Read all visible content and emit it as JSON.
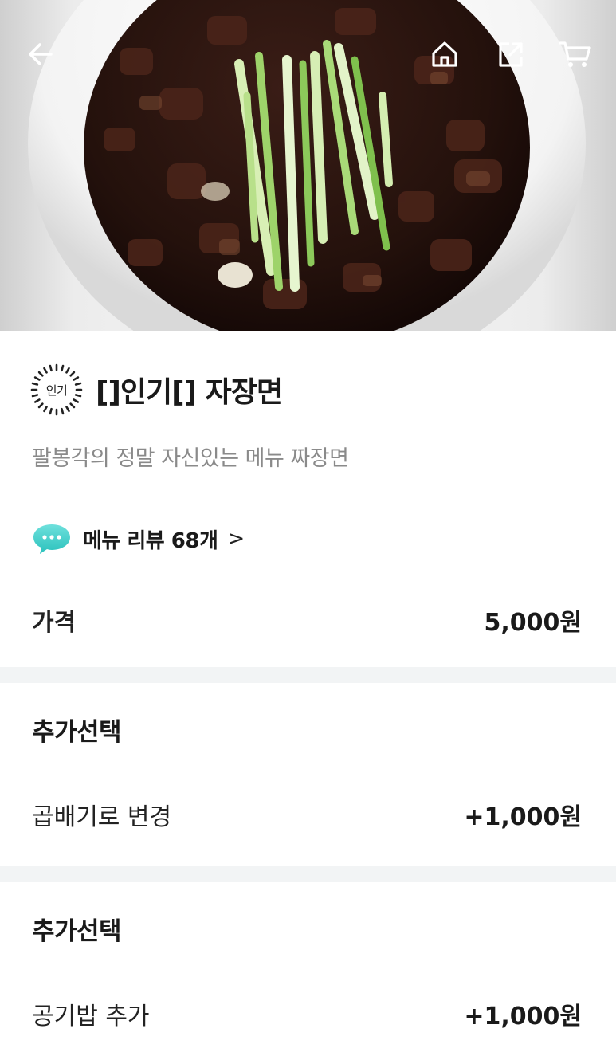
{
  "header": {
    "back_icon": "back-arrow-icon",
    "home_icon": "home-icon",
    "share_icon": "share-icon",
    "cart_icon": "cart-icon"
  },
  "hero": {
    "subject": "jajangmyeon-photo"
  },
  "menu": {
    "badge": "인기",
    "title": "[]인기[] 자장면",
    "description": "팔봉각의 정말 자신있는 메뉴 짜장면",
    "review_label": "메뉴 리뷰 68개",
    "review_chevron": ">",
    "review_icon": "speech-bubble-icon"
  },
  "price": {
    "label": "가격",
    "value": "5,000원"
  },
  "options": [
    {
      "title": "추가선택",
      "item": "곱배기로 변경",
      "price": "+1,000원"
    },
    {
      "title": "추가선택",
      "item": "공기밥 추가",
      "price": "+1,000원"
    }
  ],
  "colors": {
    "accent": "#2ac1bc",
    "divider": "#f2f4f5",
    "muted_text": "#8a8a8a"
  }
}
